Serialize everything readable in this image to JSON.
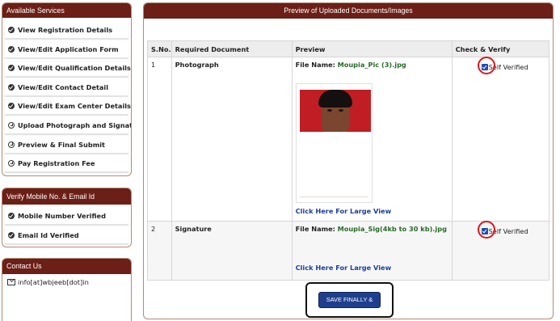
{
  "services": {
    "title": "Available Services",
    "items": [
      {
        "label": "View Registration Details",
        "icon": "check-circle-solid-icon"
      },
      {
        "label": "View/Edit Application Form",
        "icon": "check-circle-solid-icon"
      },
      {
        "label": "View/Edit Qualification Details",
        "icon": "check-circle-solid-icon"
      },
      {
        "label": "View/Edit Contact Detail",
        "icon": "check-circle-solid-icon"
      },
      {
        "label": "View/Edit Exam Center Details",
        "icon": "check-circle-solid-icon"
      },
      {
        "label": "Upload Photograph and Signature",
        "icon": "check-circle-outline-icon"
      },
      {
        "label": "Preview & Final Submit",
        "icon": "check-circle-outline-icon"
      },
      {
        "label": "Pay Registration Fee",
        "icon": "check-circle-outline-icon"
      }
    ]
  },
  "verify": {
    "title": "Verify Mobile No. & Email Id",
    "items": [
      {
        "label": "Mobile Number Verified",
        "icon": "check-circle-solid-icon"
      },
      {
        "label": "Email Id Verified",
        "icon": "check-circle-solid-icon"
      }
    ]
  },
  "contact": {
    "title": "Contact Us",
    "email": "info[at]wbjeeb[dot]in",
    "icon": "envelope-icon"
  },
  "main": {
    "title": "Preview of Uploaded Documents/Images",
    "columns": [
      "S.No.",
      "Required Document",
      "Preview",
      "Check & Verify"
    ],
    "rows": [
      {
        "sno": "1",
        "document": "Photograph",
        "file_label": "File Name:",
        "file_name": "Moupia_Pic (3).jpg",
        "link": "Click Here For Large View",
        "verify_label": "Self Verified",
        "checked": true
      },
      {
        "sno": "2",
        "document": "Signature",
        "file_label": "File Name:",
        "file_name": "Moupia_Sig(4kb to 30 kb).jpg",
        "link": "Click Here For Large View",
        "verify_label": "Self Verified",
        "checked": true
      }
    ],
    "save_button": "SAVE FINALLY & NEXT"
  },
  "colors": {
    "header": "#6b1f16",
    "link": "#1f3f9a",
    "button": "#1f3f8e",
    "highlight": "#e0151a",
    "file_name": "#2a6b2a"
  }
}
